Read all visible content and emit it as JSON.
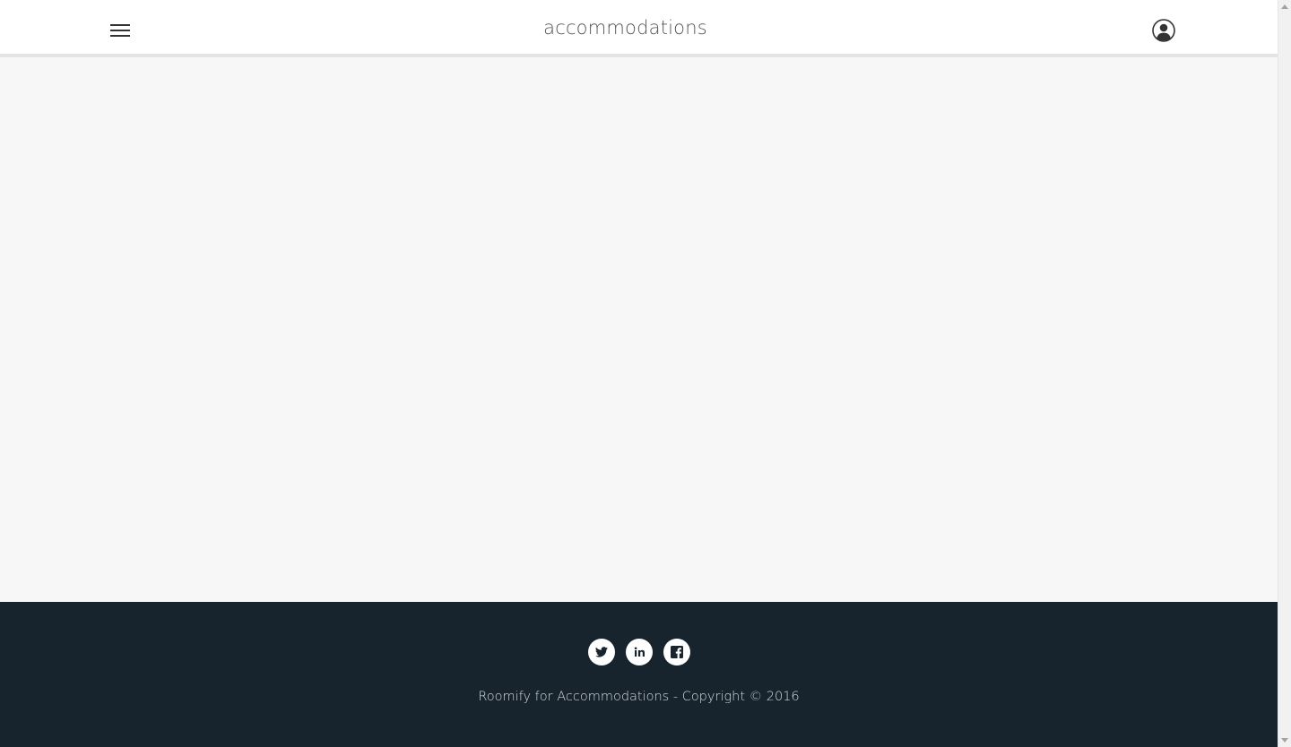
{
  "header": {
    "brand": "accommodations",
    "menu_icon": "hamburger-menu-icon",
    "user_icon": "user-account-icon"
  },
  "footer": {
    "social": [
      {
        "icon": "twitter-icon"
      },
      {
        "icon": "linkedin-icon"
      },
      {
        "icon": "facebook-icon"
      }
    ],
    "copyright": "Roomify for Accommodations - Copyright © 2016"
  },
  "colors": {
    "header_bg": "#ffffff",
    "page_bg": "#f7f7f7",
    "footer_bg": "#17242d",
    "footer_text": "#d8dde0"
  }
}
